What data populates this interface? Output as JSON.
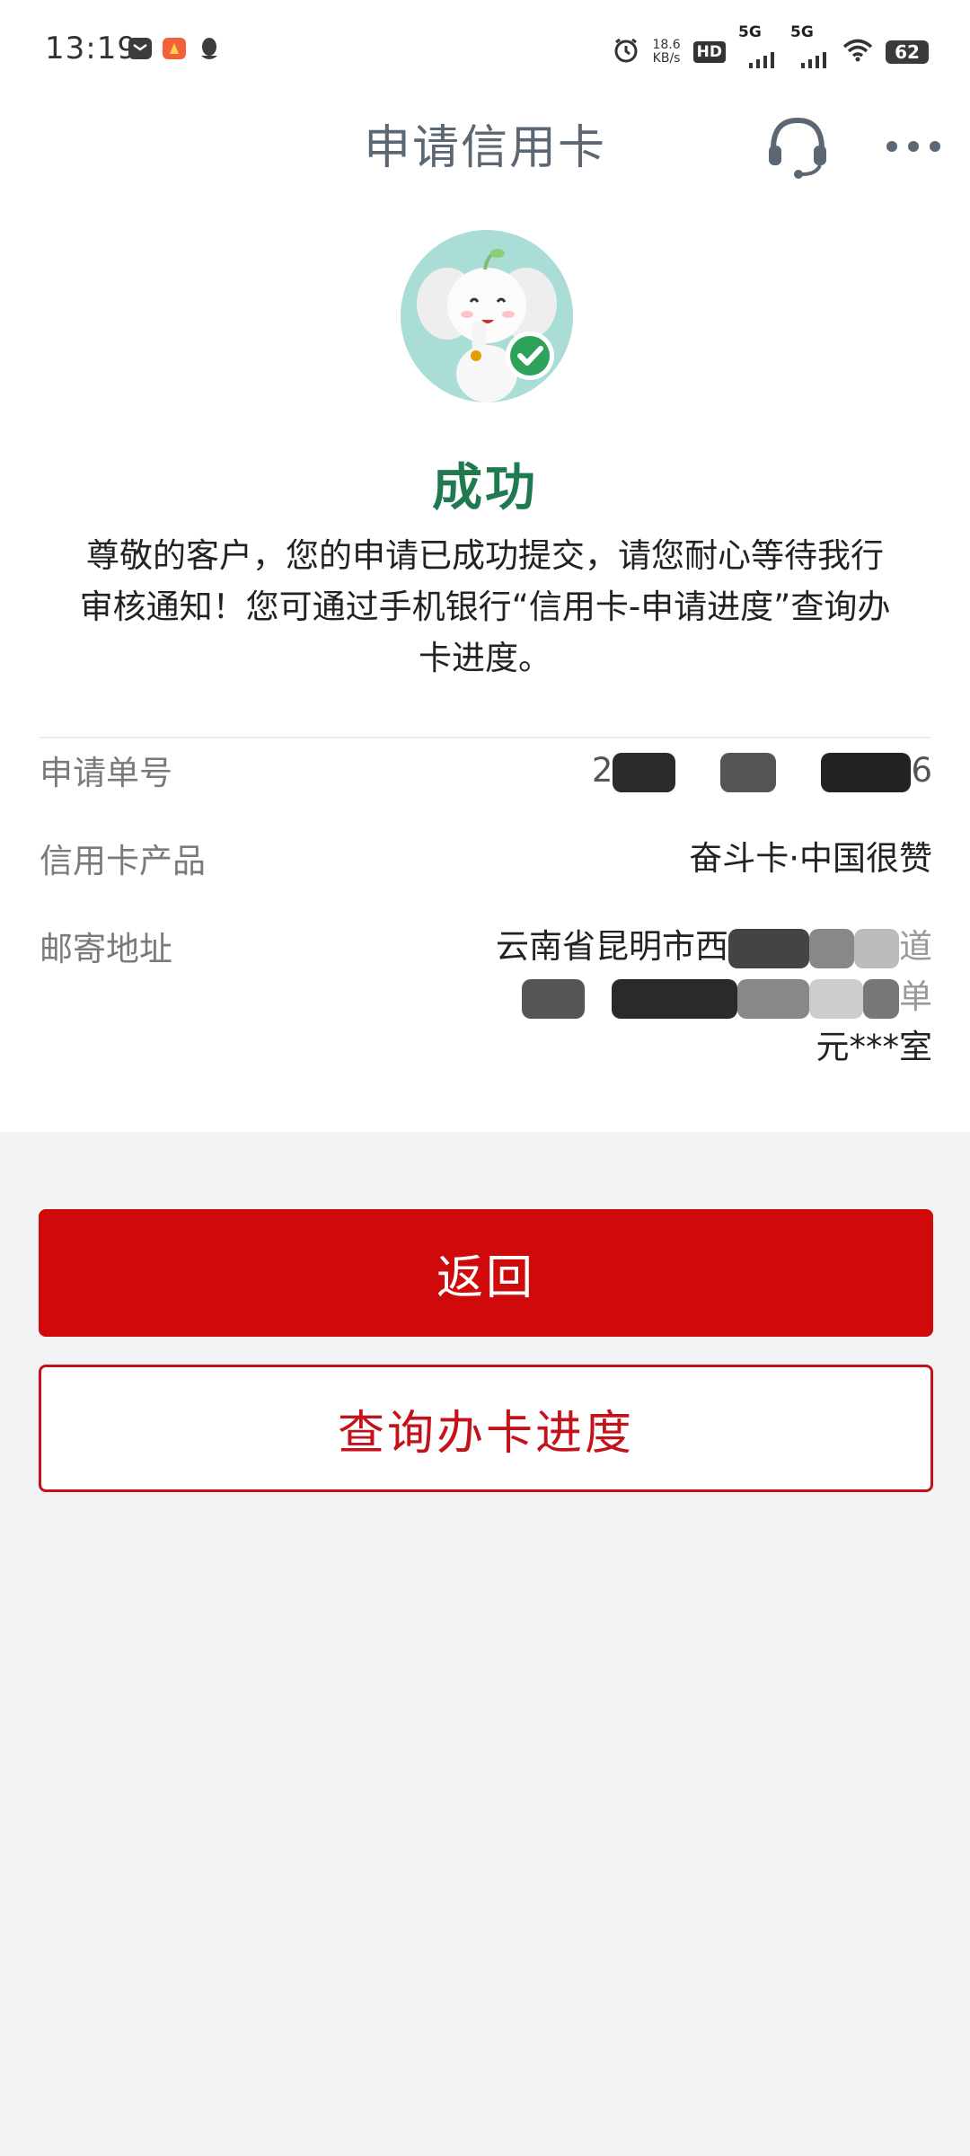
{
  "status_bar": {
    "time": "13:19",
    "net_speed_value": "18.6",
    "net_speed_unit": "KB/s",
    "hd_label": "HD",
    "signal_1": "5G",
    "signal_2": "5G",
    "battery": "62",
    "icons": [
      "mail-icon",
      "app-notification-icon",
      "qq-icon",
      "alarm-icon",
      "wifi-icon"
    ]
  },
  "header": {
    "title": "申请信用卡",
    "icons": [
      "customer-service-icon",
      "more-icon"
    ]
  },
  "result": {
    "title": "成功",
    "description": "尊敬的客户，您的申请已成功提交，请您耐心等待我行审核通知！您可通过手机银行“信用卡-申请进度”查询办卡进度。"
  },
  "details": {
    "application_no_label": "申请单号",
    "application_no_prefix": "2",
    "application_no_suffix": "6",
    "product_label": "信用卡产品",
    "product_value": "奋斗卡·中国很赞",
    "address_label": "邮寄地址",
    "address_line1_prefix": "云南省昆明市西",
    "address_line1_suffix": "道",
    "address_line2_suffix": "单",
    "address_line3": "元***室"
  },
  "actions": {
    "back_label": "返回",
    "progress_label": "查询办卡进度"
  },
  "colors": {
    "primary_red": "#d00a0a",
    "outline_red": "#c3121a",
    "success_green": "#1f7a4f",
    "title_gray": "#5b6773"
  }
}
